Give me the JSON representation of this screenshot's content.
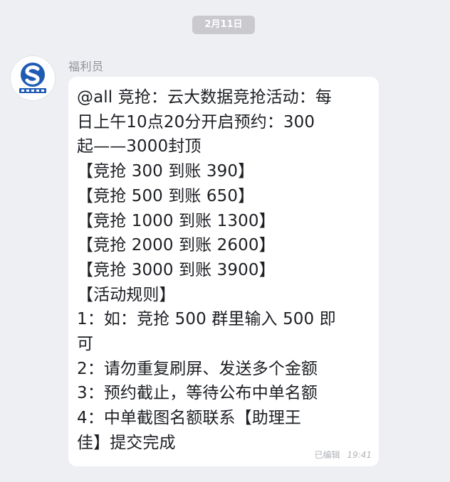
{
  "chat": {
    "date_divider": "2月11日",
    "sender": {
      "name": "福利员",
      "avatar_icon": "s-logo-avatar"
    },
    "message": {
      "lines": [
        "@all 竞抢：云大数据竞抢活动：每",
        "日上午10点20分开启预约：300",
        "起——3000封顶",
        "【竞抢 300 到账 390】",
        "【竞抢 500 到账 650】",
        "【竞抢 1000 到账 1300】",
        "【竞抢 2000 到账 2600】",
        "【竞抢 3000 到账 3900】",
        "【活动规则】",
        "1：如：竞抢 500 群里输入 500 即",
        "可",
        "2：请勿重复刷屏、发送多个金额",
        "3：预约截止，等待公布中单名额",
        "4：中单截图名额联系【助理王",
        "佳】提交完成"
      ],
      "edited_label": "已编辑",
      "time": "19:41"
    }
  },
  "colors": {
    "background": "#eeeff2",
    "bubble": "#ffffff",
    "text": "#1d1f24",
    "muted": "#8f939a",
    "date_pill": "#c9c9ce",
    "avatar_accent": "#1f5bb5"
  }
}
